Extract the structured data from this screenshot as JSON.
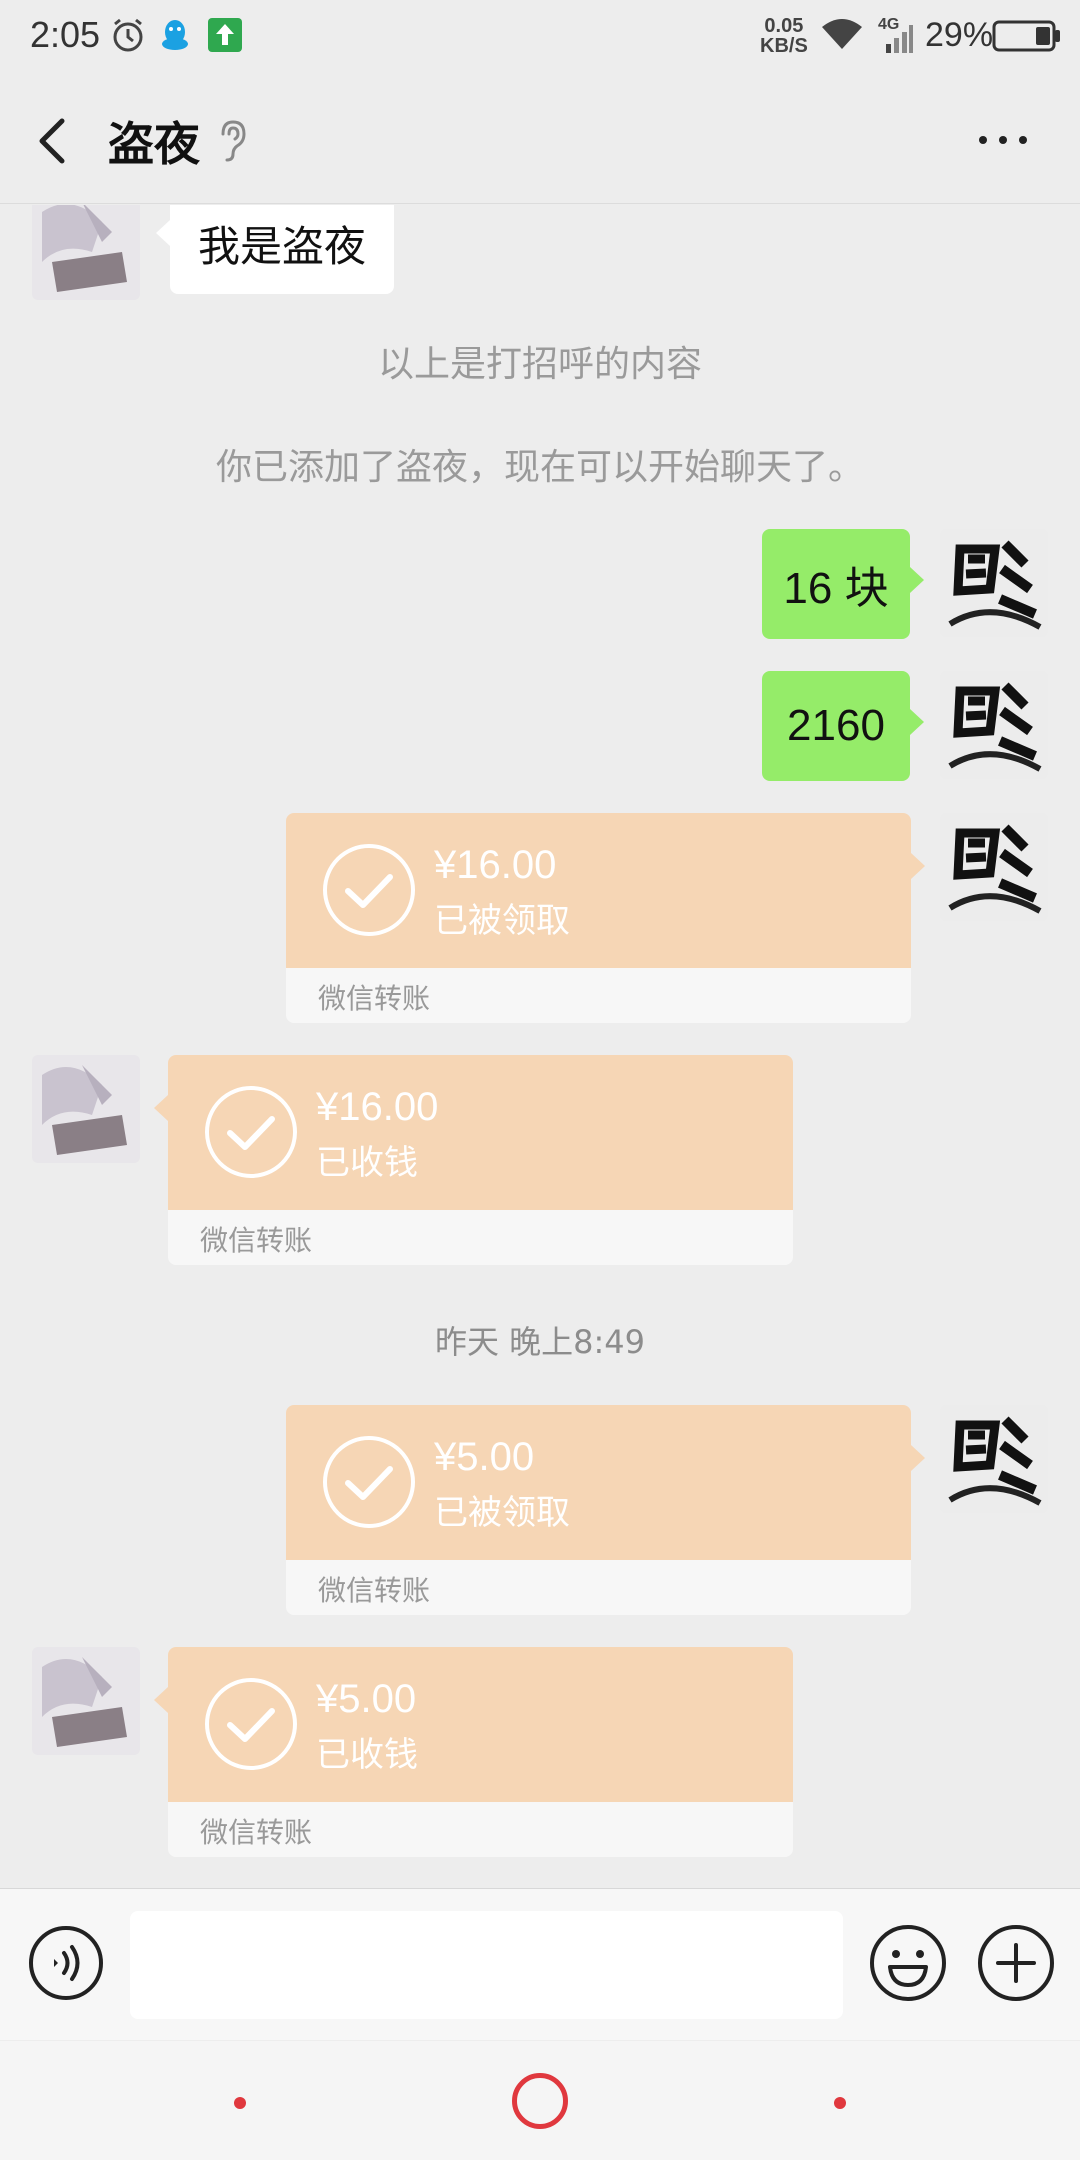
{
  "status_bar": {
    "time": "2:05",
    "net_speed_value": "0.05",
    "net_speed_unit": "KB/S",
    "signal_type": "4G",
    "battery_percent": "29%",
    "icons": [
      "alarm-icon",
      "qq-icon",
      "upload-icon",
      "wifi-icon",
      "signal-icon",
      "battery-icon"
    ]
  },
  "header": {
    "title": "盗夜",
    "back_icon": "chevron-left-icon",
    "ear_icon": "ear-icon",
    "more_icon": "more-icon"
  },
  "messages": {
    "greeting_text": "我是盗夜",
    "system_greeting_note": "以上是打招呼的内容",
    "system_added_note": "你已添加了盗夜，现在可以开始聊天了。",
    "sent_text_1": "16 块",
    "sent_text_2": "2160",
    "time_divider": "昨天 晚上8:49",
    "transfers": [
      {
        "amount": "¥16.00",
        "status": "已被领取",
        "label": "微信转账",
        "direction": "sent"
      },
      {
        "amount": "¥16.00",
        "status": "已收钱",
        "label": "微信转账",
        "direction": "received"
      },
      {
        "amount": "¥5.00",
        "status": "已被领取",
        "label": "微信转账",
        "direction": "sent"
      },
      {
        "amount": "¥5.00",
        "status": "已收钱",
        "label": "微信转账",
        "direction": "received"
      }
    ]
  },
  "input_bar": {
    "message_value": "",
    "voice_icon": "voice-icon",
    "emoji_icon": "emoji-icon",
    "plus_icon": "plus-icon"
  },
  "colors": {
    "background": "#ededed",
    "sent_bubble": "#95ec69",
    "transfer_card": "#f6d6b5",
    "nav_accent": "#e0383e"
  }
}
